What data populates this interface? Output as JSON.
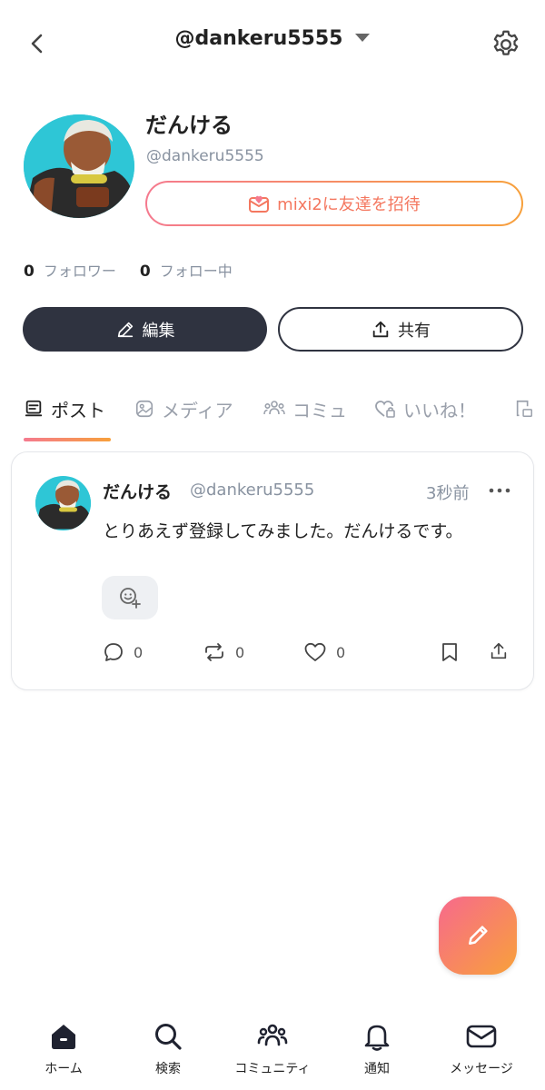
{
  "header": {
    "title": "@dankeru5555",
    "back_icon": "chevron-left-icon",
    "dropdown_icon": "caret-down-icon",
    "settings_icon": "gear-icon"
  },
  "profile": {
    "display_name": "だんける",
    "handle": "@dankeru5555",
    "invite_label": "mixi2に友達を招待",
    "followers_count": "0",
    "followers_label": "フォロワー",
    "following_count": "0",
    "following_label": "フォロー中",
    "edit_label": "編集",
    "share_label": "共有"
  },
  "tabs": [
    {
      "label": "ポスト",
      "icon": "post-icon",
      "active": true
    },
    {
      "label": "メディア",
      "icon": "image-icon",
      "active": false
    },
    {
      "label": "コミュ",
      "icon": "community-icon",
      "active": false
    },
    {
      "label": "いいね！",
      "icon": "heart-lock-icon",
      "active": false
    }
  ],
  "post": {
    "name": "だんける",
    "handle": "@dankeru5555",
    "time": "3秒前",
    "text": "とりあえず登録してみました。だんけるです。",
    "reply_count": "0",
    "repost_count": "0",
    "like_count": "0"
  },
  "bottom_nav": [
    {
      "label": "ホーム",
      "icon": "home-icon"
    },
    {
      "label": "検索",
      "icon": "search-icon"
    },
    {
      "label": "コミュニティ",
      "icon": "community-icon"
    },
    {
      "label": "通知",
      "icon": "bell-icon"
    },
    {
      "label": "メッセージ",
      "icon": "mail-icon"
    }
  ],
  "colors": {
    "accent_gradient_start": "#f57a8f",
    "accent_gradient_end": "#f7a03b",
    "dark_button": "#2f3340",
    "muted_text": "#8892a0"
  }
}
